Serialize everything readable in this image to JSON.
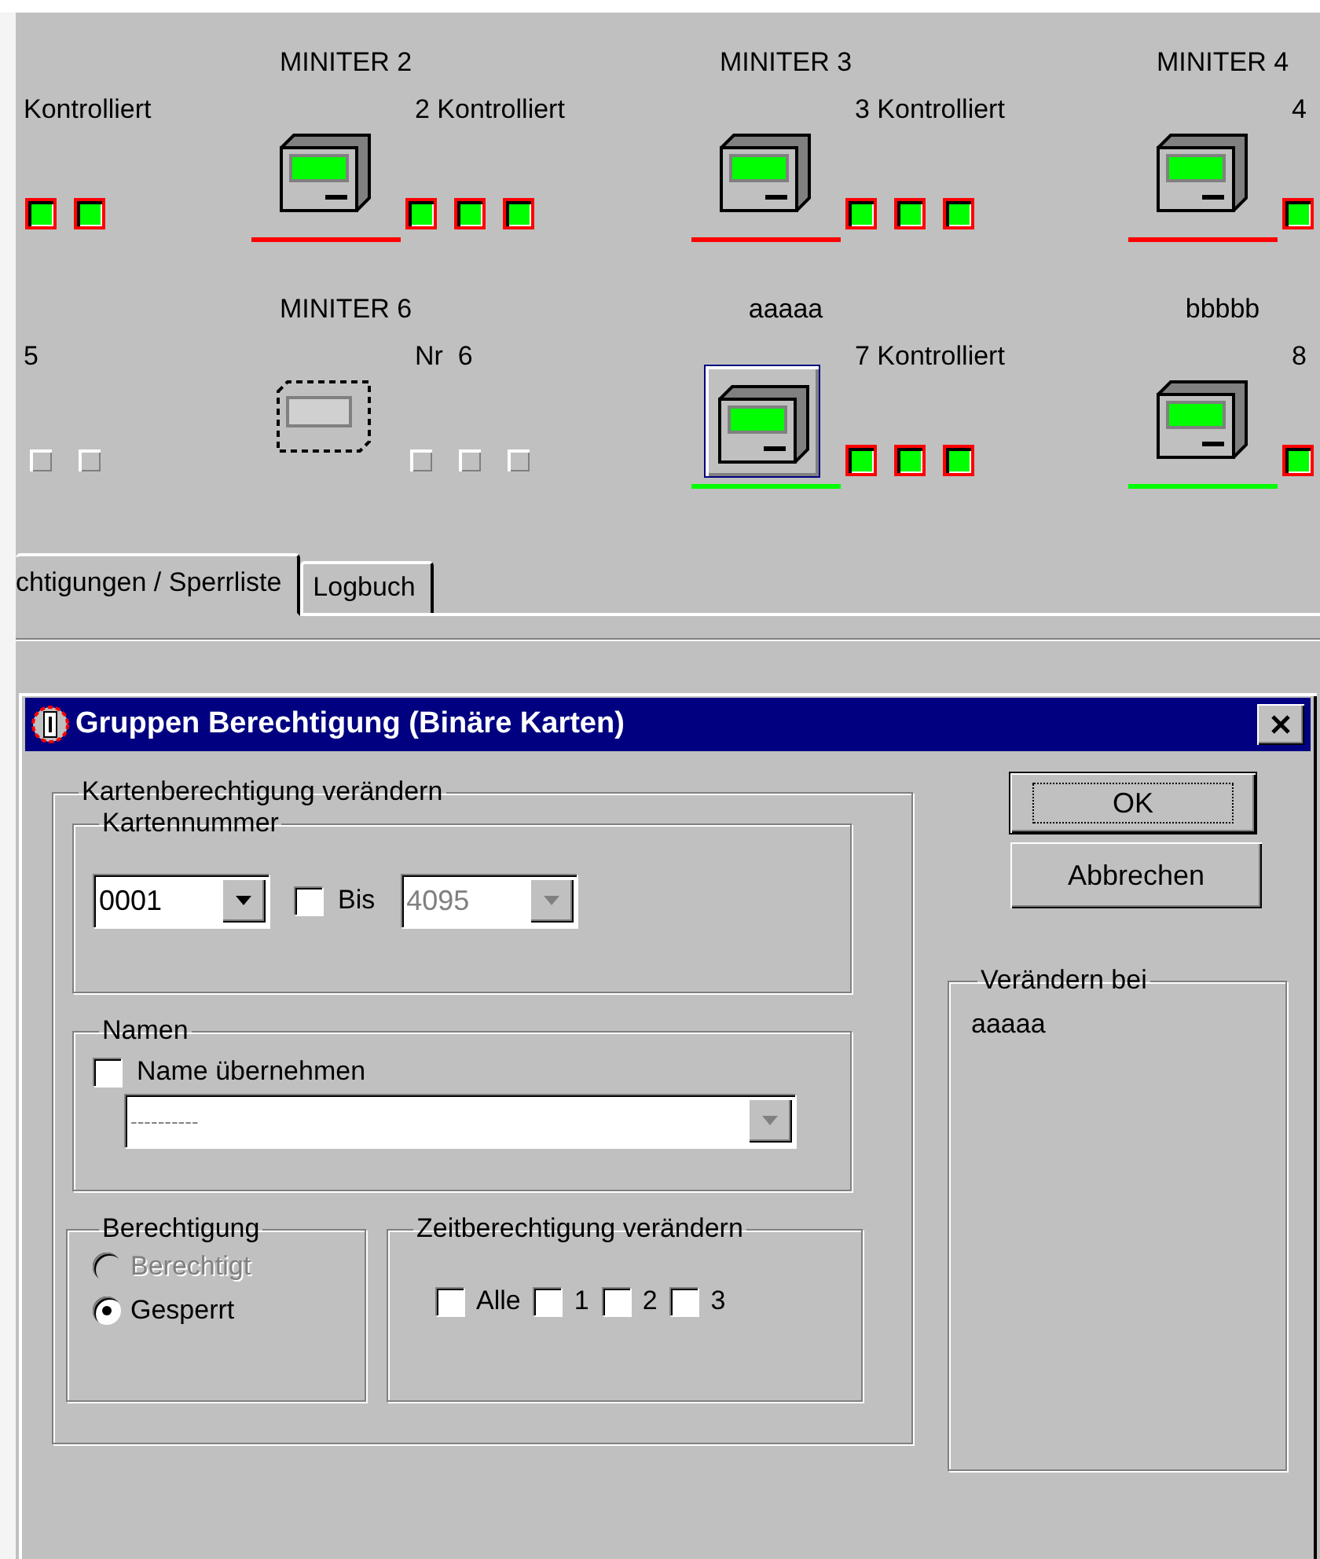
{
  "devices": [
    {
      "kind": "none",
      "status": "Kontrolliert",
      "selected": false,
      "lights": [
        {
          "on": true
        },
        {
          "on": true
        }
      ]
    },
    {
      "kind": "terminal",
      "title": "MINITER 2",
      "status": "2 Kontrolliert",
      "selected": false,
      "color": "#ff0000",
      "lights": [
        {
          "on": true
        },
        {
          "on": true
        },
        {
          "on": true
        }
      ]
    },
    {
      "kind": "terminal",
      "title": "MINITER 3",
      "status": "3 Kontrolliert",
      "selected": false,
      "color": "#ff0000",
      "lights": [
        {
          "on": true
        },
        {
          "on": true
        },
        {
          "on": true
        }
      ]
    },
    {
      "kind": "terminal",
      "title": "MINITER 4",
      "status": "4",
      "selected": false,
      "color": "#ff0000",
      "lights": [
        {
          "on": true
        }
      ]
    },
    {
      "kind": "none",
      "status": "5",
      "selected": false,
      "lights": [
        {
          "on": false
        },
        {
          "on": false
        }
      ]
    },
    {
      "kind": "offline",
      "title": "MINITER 6",
      "status": "Nr  6",
      "selected": false,
      "lights": [
        {
          "on": false
        },
        {
          "on": false
        },
        {
          "on": false
        }
      ]
    },
    {
      "kind": "terminal",
      "title": "aaaaa",
      "status": "7 Kontrolliert",
      "selected": true,
      "color": "#00ff00",
      "lights": [
        {
          "on": true
        },
        {
          "on": true
        },
        {
          "on": true
        }
      ]
    },
    {
      "kind": "terminal",
      "title": "bbbbb",
      "status": "8",
      "selected": false,
      "color": "#00ff00",
      "lights": [
        {
          "on": true
        }
      ]
    }
  ],
  "tabs": [
    {
      "label": "chtigungen / Sperrliste",
      "selected": true
    },
    {
      "label": "Logbuch",
      "selected": false
    }
  ],
  "dialog": {
    "title": "Gruppen Berechtigung (Binäre Karten)",
    "main_group": {
      "label": "Kartenberechtigung verändern"
    },
    "card_number": {
      "label": "Kartennummer",
      "from": {
        "value": "0001",
        "disabled": false
      },
      "to_checkbox": {
        "label": "Bis",
        "checked": false
      },
      "to": {
        "value": "4095",
        "disabled": true
      }
    },
    "names": {
      "label": "Namen",
      "checkbox": {
        "label": "Name übernehmen",
        "checked": false
      },
      "select": {
        "value": "----------",
        "disabled": true
      }
    },
    "permission": {
      "label": "Berechtigung",
      "options": [
        {
          "label": "Berechtigt",
          "selected": false,
          "disabled": true
        },
        {
          "label": "Gesperrt",
          "selected": true,
          "disabled": false
        }
      ]
    },
    "time": {
      "label": "Zeitberechtigung verändern",
      "options": [
        {
          "label": "Alle",
          "checked": false
        },
        {
          "label": "1",
          "checked": false
        },
        {
          "label": "2",
          "checked": false
        },
        {
          "label": "3",
          "checked": false
        }
      ]
    },
    "buttons": [
      {
        "label": "OK",
        "default": true
      },
      {
        "label": "Abbrechen",
        "default": false
      }
    ],
    "apply_to": {
      "label": "Verändern bei",
      "items": [
        "aaaaa"
      ]
    }
  }
}
